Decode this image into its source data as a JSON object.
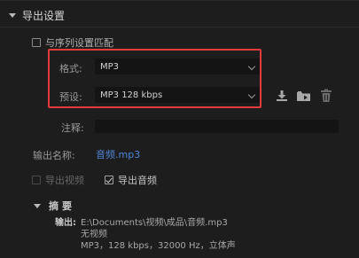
{
  "export_settings": {
    "section_title": "导出设置",
    "match_sequence_label": "与序列设置匹配",
    "format_label": "格式:",
    "format_value": "MP3",
    "preset_label": "预设:",
    "preset_value": "MP3 128 kbps",
    "comment_label": "注释:",
    "comment_value": "",
    "output_name_label": "输出名称:",
    "output_name_value": "音频.mp3",
    "export_video_label": "导出视频",
    "export_audio_label": "导出音频"
  },
  "summary": {
    "title": "摘要",
    "output_label": "输出:",
    "output_path": "E:\\Documents\\视频\\成品\\音频.mp3",
    "video_line": "无视频",
    "audio_line": "MP3，128 kbps，32000 Hz，立体声"
  },
  "icons": {
    "save_preset": "download-icon",
    "import_preset": "folder-icon",
    "delete_preset": "trash-icon"
  },
  "colors": {
    "highlight_box": "#e33b3b",
    "link": "#4f86d9",
    "background": "#1d1d1d"
  }
}
